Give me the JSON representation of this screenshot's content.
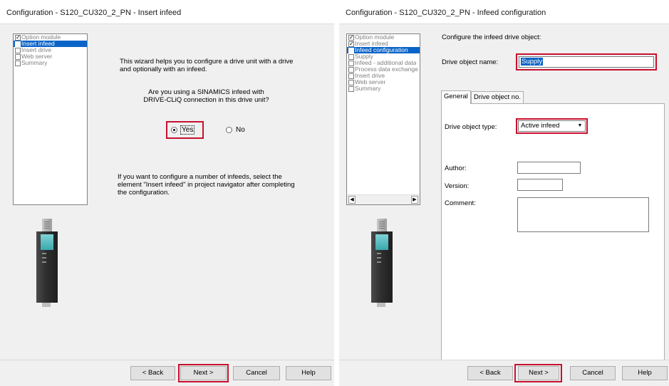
{
  "left_dialog": {
    "title": "Configuration - S120_CU320_2_PN - Insert infeed",
    "nav_items": [
      {
        "label": "Option module",
        "checked": true,
        "selected": false
      },
      {
        "label": "Insert infeed",
        "checked": false,
        "selected": true
      },
      {
        "label": "Insert drive",
        "checked": false,
        "selected": false
      },
      {
        "label": "Web server",
        "checked": false,
        "selected": false
      },
      {
        "label": "Summary",
        "checked": false,
        "selected": false
      }
    ],
    "intro_line1": "This wizard helps you to configure a drive unit with a drive",
    "intro_line2": "and optionally with an infeed.",
    "question_line1": "Are you using a SINAMICS infeed with",
    "question_line2": "DRIVE-CLiQ connection in this drive unit?",
    "radio_yes": "Yes",
    "radio_no": "No",
    "selected_option": "Yes",
    "hint_line1": "If you want to configure a number of infeeds, select the",
    "hint_line2": "element \"Insert infeed\" in project navigator after completing",
    "hint_line3": "the configuration.",
    "buttons": {
      "back": "< Back",
      "next": "Next >",
      "cancel": "Cancel",
      "help": "Help"
    }
  },
  "right_dialog": {
    "title": "Configuration - S120_CU320_2_PN - Infeed configuration",
    "nav_items": [
      {
        "label": "Option module",
        "checked": true,
        "selected": false
      },
      {
        "label": "Insert infeed",
        "checked": true,
        "selected": false
      },
      {
        "label": "Infeed configuration",
        "checked": false,
        "selected": true
      },
      {
        "label": "Supply",
        "checked": false,
        "selected": false
      },
      {
        "label": "Infeed - additional data",
        "checked": false,
        "selected": false
      },
      {
        "label": "Process data exchange",
        "checked": false,
        "selected": false
      },
      {
        "label": "Insert drive",
        "checked": false,
        "selected": false
      },
      {
        "label": "Web server",
        "checked": false,
        "selected": false
      },
      {
        "label": "Summary",
        "checked": false,
        "selected": false
      }
    ],
    "heading": "Configure the infeed drive object:",
    "drive_object_name_label": "Drive object name:",
    "drive_object_name_value": "Supply",
    "tabs": [
      "General",
      "Drive object no."
    ],
    "drive_object_type_label": "Drive object type:",
    "drive_object_type_value": "Active infeed",
    "author_label": "Author:",
    "author_value": "",
    "version_label": "Version:",
    "version_value": "",
    "comment_label": "Comment:",
    "comment_value": "",
    "buttons": {
      "back": "< Back",
      "next": "Next >",
      "cancel": "Cancel",
      "help": "Help"
    }
  },
  "colors": {
    "highlight_red": "#c8102e",
    "selection_blue": "#0a64c8",
    "dialog_bg": "#f0f0f0"
  },
  "icons": [
    "checkbox-checked-icon",
    "checkbox-icon",
    "radio-selected-icon",
    "radio-icon",
    "dropdown-arrow-icon",
    "scroll-left-icon",
    "scroll-right-icon",
    "drive-module-image"
  ]
}
